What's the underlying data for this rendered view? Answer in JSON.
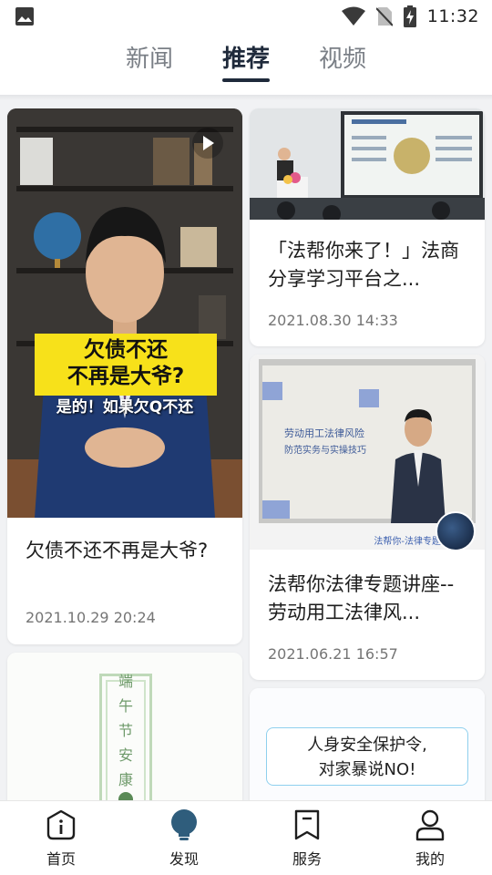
{
  "status_bar": {
    "time": "11:32",
    "icons": [
      "image-notification-icon",
      "wifi-icon",
      "no-sim-icon",
      "battery-charging-icon"
    ]
  },
  "tabs": [
    {
      "label": "新闻",
      "active": false
    },
    {
      "label": "推荐",
      "active": true
    },
    {
      "label": "视频",
      "active": false
    }
  ],
  "feed": {
    "left": [
      {
        "title": "欠债不还不再是大爷?",
        "time": "2021.10.29  20:24",
        "thumb_caption_line1": "欠债不还",
        "thumb_caption_line2": "不再是大爷?",
        "thumb_subtitle": "是的！如果欠Q不还",
        "is_video": true
      },
      {
        "thumb_vertical_text": [
          "端",
          "午",
          "节",
          "安",
          "康"
        ]
      }
    ],
    "right": [
      {
        "title": "「法帮你来了！」法商分享学习平台之...",
        "time": "2021.08.30  14:33"
      },
      {
        "title": "法帮你法律专题讲座--劳动用工法律风...",
        "time": "2021.06.21  16:57",
        "thumb_slide_title": "劳动用工法律风险",
        "thumb_slide_subtitle": "防范实务与实操技巧",
        "thumb_footer": "法帮你-法律专题讲座"
      },
      {
        "thumb_text_line1": "人身安全保护令,",
        "thumb_text_line2": "对家暴说NO!"
      }
    ]
  },
  "bottom_nav": [
    {
      "label": "首页",
      "icon": "info-icon",
      "active": false
    },
    {
      "label": "发现",
      "icon": "bulb-icon",
      "active": true
    },
    {
      "label": "服务",
      "icon": "bookmark-icon",
      "active": false
    },
    {
      "label": "我的",
      "icon": "user-icon",
      "active": false
    }
  ],
  "colors": {
    "accent": "#1f2a3b",
    "nav_active": "#2f5d7c",
    "background": "#f1f2f4",
    "time_text": "#757575"
  }
}
